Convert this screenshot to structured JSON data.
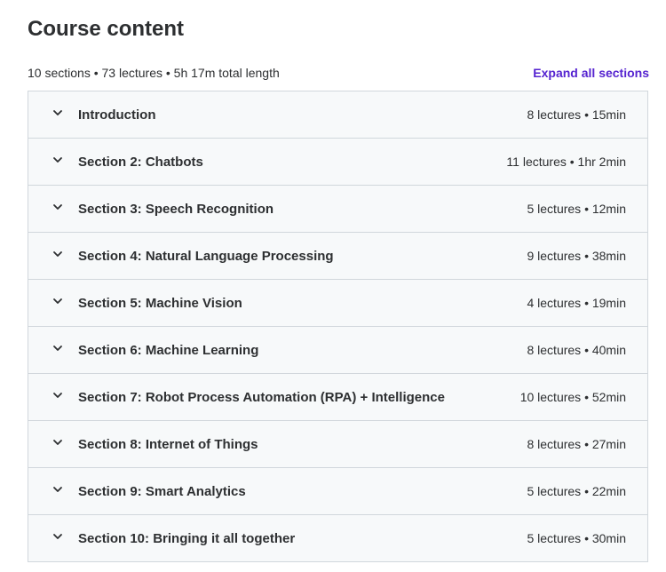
{
  "header": {
    "title": "Course content"
  },
  "summary": {
    "text": "10 sections • 73 lectures • 5h 17m total length",
    "expand_label": "Expand all sections"
  },
  "colors": {
    "accent": "#5624d0",
    "row_background": "#f7f9fa",
    "border": "#d1d7dc",
    "text": "#2d2f31"
  },
  "sections": [
    {
      "title": "Introduction",
      "meta": "8 lectures • 15min",
      "icon": "chevron-down-icon"
    },
    {
      "title": "Section 2: Chatbots",
      "meta": "11 lectures • 1hr 2min",
      "icon": "chevron-down-icon"
    },
    {
      "title": "Section 3: Speech Recognition",
      "meta": "5 lectures • 12min",
      "icon": "chevron-down-icon"
    },
    {
      "title": "Section 4: Natural Language Processing",
      "meta": "9 lectures • 38min",
      "icon": "chevron-down-icon"
    },
    {
      "title": "Section 5: Machine Vision",
      "meta": "4 lectures • 19min",
      "icon": "chevron-down-icon"
    },
    {
      "title": "Section 6: Machine Learning",
      "meta": "8 lectures • 40min",
      "icon": "chevron-down-icon"
    },
    {
      "title": "Section 7: Robot Process Automation (RPA) + Intelligence",
      "meta": "10 lectures • 52min",
      "icon": "chevron-down-icon"
    },
    {
      "title": "Section 8: Internet of Things",
      "meta": "8 lectures • 27min",
      "icon": "chevron-down-icon"
    },
    {
      "title": "Section 9: Smart Analytics",
      "meta": "5 lectures • 22min",
      "icon": "chevron-down-icon"
    },
    {
      "title": "Section 10: Bringing it all together",
      "meta": "5 lectures • 30min",
      "icon": "chevron-down-icon"
    }
  ]
}
